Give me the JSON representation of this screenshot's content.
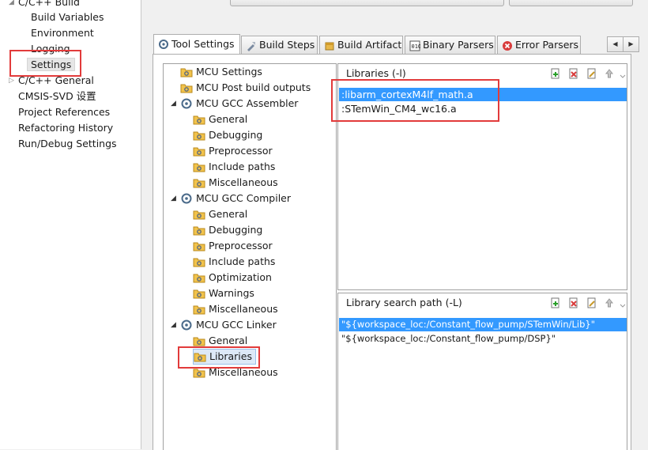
{
  "nav": {
    "items": [
      {
        "label": "C/C++ Build",
        "indent": 0,
        "arrow": ""
      },
      {
        "label": "Build Variables",
        "indent": 1,
        "arrow": ""
      },
      {
        "label": "Environment",
        "indent": 1,
        "arrow": ""
      },
      {
        "label": "Logging",
        "indent": 1,
        "arrow": ""
      },
      {
        "label": "Settings",
        "indent": 1,
        "arrow": ""
      },
      {
        "label": "C/C++ General",
        "indent": 0,
        "arrow": "▷"
      },
      {
        "label": "CMSIS-SVD 设置",
        "indent": 0,
        "arrow": ""
      },
      {
        "label": "Project References",
        "indent": 0,
        "arrow": ""
      },
      {
        "label": "Refactoring History",
        "indent": 0,
        "arrow": ""
      },
      {
        "label": "Run/Debug Settings",
        "indent": 0,
        "arrow": ""
      }
    ]
  },
  "tabs": [
    {
      "label": "Tool Settings",
      "icon": "tool-settings-icon"
    },
    {
      "label": "Build Steps",
      "icon": "build-steps-icon"
    },
    {
      "label": "Build Artifact",
      "icon": "build-artifact-icon"
    },
    {
      "label": "Binary Parsers",
      "icon": "binary-parsers-icon"
    },
    {
      "label": "Error Parsers",
      "icon": "error-parsers-icon"
    }
  ],
  "tab_nav": {
    "left_arrow": "◀",
    "right_arrow": "▶"
  },
  "tree": {
    "items": [
      {
        "label": "MCU Settings",
        "level": 0,
        "expander": ""
      },
      {
        "label": "MCU Post build outputs",
        "level": 0,
        "expander": ""
      },
      {
        "label": "MCU GCC Assembler",
        "level": 0,
        "expander": "◢"
      },
      {
        "label": "General",
        "level": 1,
        "expander": ""
      },
      {
        "label": "Debugging",
        "level": 1,
        "expander": ""
      },
      {
        "label": "Preprocessor",
        "level": 1,
        "expander": ""
      },
      {
        "label": "Include paths",
        "level": 1,
        "expander": ""
      },
      {
        "label": "Miscellaneous",
        "level": 1,
        "expander": ""
      },
      {
        "label": "MCU GCC Compiler",
        "level": 0,
        "expander": "◢"
      },
      {
        "label": "General",
        "level": 1,
        "expander": ""
      },
      {
        "label": "Debugging",
        "level": 1,
        "expander": ""
      },
      {
        "label": "Preprocessor",
        "level": 1,
        "expander": ""
      },
      {
        "label": "Include paths",
        "level": 1,
        "expander": ""
      },
      {
        "label": "Optimization",
        "level": 1,
        "expander": ""
      },
      {
        "label": "Warnings",
        "level": 1,
        "expander": ""
      },
      {
        "label": "Miscellaneous",
        "level": 1,
        "expander": ""
      },
      {
        "label": "MCU GCC Linker",
        "level": 0,
        "expander": "◢"
      },
      {
        "label": "General",
        "level": 1,
        "expander": ""
      },
      {
        "label": "Libraries",
        "level": 1,
        "expander": ""
      },
      {
        "label": "Miscellaneous",
        "level": 1,
        "expander": ""
      }
    ]
  },
  "libraries": {
    "title": "Libraries (-l)",
    "rows": [
      ":libarm_cortexM4lf_math.a",
      ":STemWin_CM4_wc16.a"
    ]
  },
  "search_paths": {
    "title": "Library search path (-L)",
    "rows": [
      "\"${workspace_loc:/Constant_flow_pump/STemWin/Lib}\"",
      "\"${workspace_loc:/Constant_flow_pump/DSP}\""
    ]
  },
  "colors": {
    "selection": "#3399ff",
    "highlight_box": "#e23b3b",
    "folder": "#f2c34b"
  }
}
